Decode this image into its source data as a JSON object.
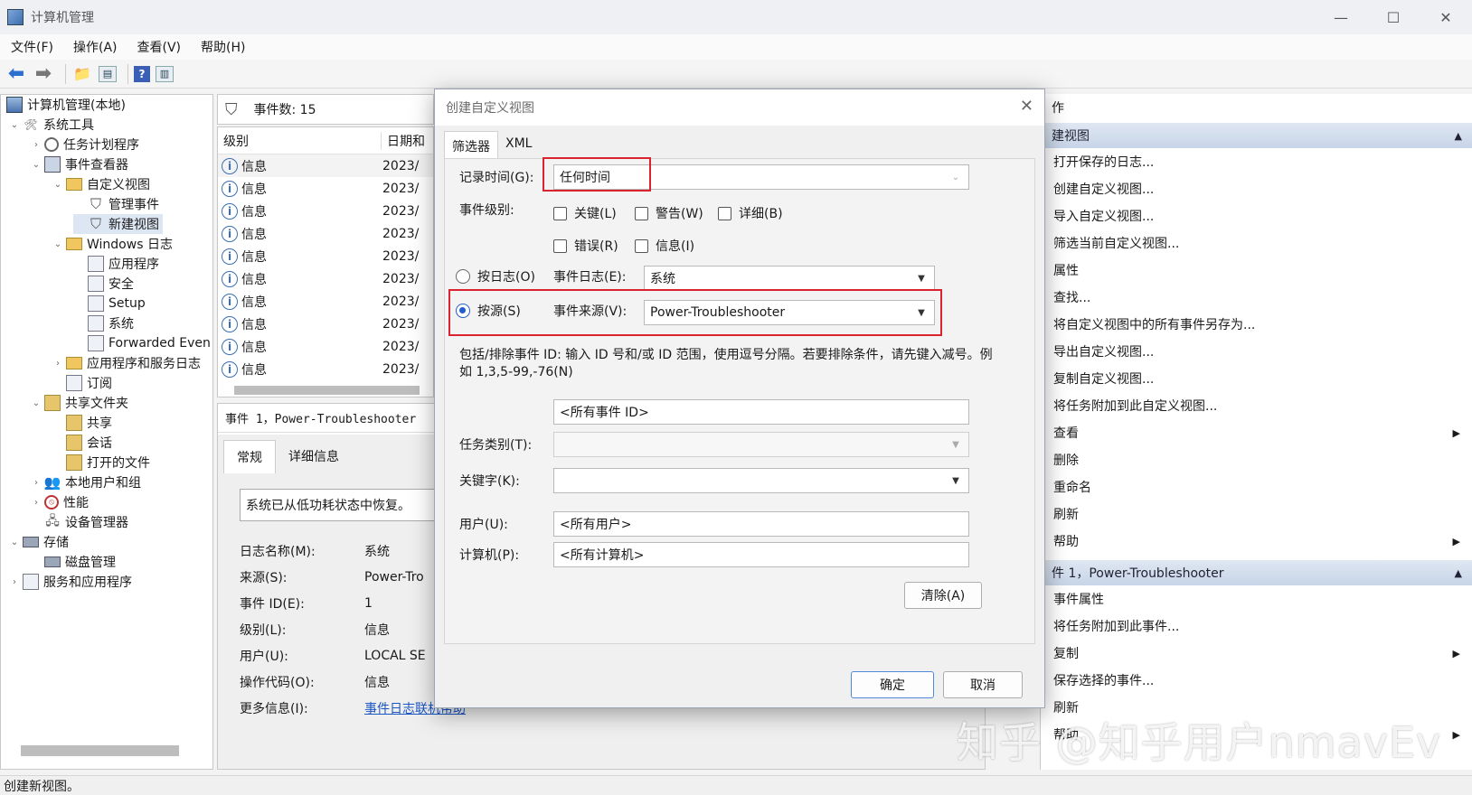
{
  "window": {
    "title": "计算机管理"
  },
  "menu": [
    "文件(F)",
    "操作(A)",
    "查看(V)",
    "帮助(H)"
  ],
  "tree": {
    "items": [
      {
        "label": "计算机管理(本地)"
      },
      {
        "label": "系统工具"
      },
      {
        "label": "任务计划程序"
      },
      {
        "label": "事件查看器"
      },
      {
        "label": "自定义视图"
      },
      {
        "label": "管理事件"
      },
      {
        "label": "新建视图"
      },
      {
        "label": "Windows 日志"
      },
      {
        "label": "应用程序"
      },
      {
        "label": "安全"
      },
      {
        "label": "Setup"
      },
      {
        "label": "系统"
      },
      {
        "label": "Forwarded Even"
      },
      {
        "label": "应用程序和服务日志"
      },
      {
        "label": "订阅"
      },
      {
        "label": "共享文件夹"
      },
      {
        "label": "共享"
      },
      {
        "label": "会话"
      },
      {
        "label": "打开的文件"
      },
      {
        "label": "本地用户和组"
      },
      {
        "label": "性能"
      },
      {
        "label": "设备管理器"
      },
      {
        "label": "存储"
      },
      {
        "label": "磁盘管理"
      },
      {
        "label": "服务和应用程序"
      }
    ]
  },
  "events": {
    "count_label": "事件数: 15",
    "col_level": "级别",
    "col_date": "日期和",
    "rows": [
      {
        "level": "信息",
        "date": "2023/"
      },
      {
        "level": "信息",
        "date": "2023/"
      },
      {
        "level": "信息",
        "date": "2023/"
      },
      {
        "level": "信息",
        "date": "2023/"
      },
      {
        "level": "信息",
        "date": "2023/"
      },
      {
        "level": "信息",
        "date": "2023/"
      },
      {
        "level": "信息",
        "date": "2023/"
      },
      {
        "level": "信息",
        "date": "2023/"
      },
      {
        "level": "信息",
        "date": "2023/"
      },
      {
        "level": "信息",
        "date": "2023/"
      }
    ]
  },
  "detail": {
    "title": "事件 1，Power-Troubleshooter",
    "tabs": [
      "常规",
      "详细信息"
    ],
    "message": "系统已从低功耗状态中恢复。",
    "fields": [
      {
        "label": "日志名称(M):",
        "value": "系统"
      },
      {
        "label": "来源(S):",
        "value": "Power-Tro"
      },
      {
        "label": "事件 ID(E):",
        "value": "1"
      },
      {
        "label": "级别(L):",
        "value": "信息"
      },
      {
        "label": "用户(U):",
        "value": "LOCAL SE"
      },
      {
        "label": "操作代码(O):",
        "value": "信息"
      },
      {
        "label": "更多信息(I):",
        "value": "事件日志联机帮助"
      }
    ]
  },
  "actions": {
    "title": "作",
    "section1": "建视图",
    "items1": [
      "打开保存的日志...",
      "创建自定义视图...",
      "导入自定义视图...",
      "筛选当前自定义视图...",
      "属性",
      "查找...",
      "将自定义视图中的所有事件另存为...",
      "导出自定义视图...",
      "复制自定义视图...",
      "将任务附加到此自定义视图...",
      "查看",
      "删除",
      "重命名",
      "刷新",
      "帮助"
    ],
    "section2": "件 1，Power-Troubleshooter",
    "items2": [
      "事件属性",
      "将任务附加到此事件...",
      "复制",
      "保存选择的事件...",
      "刷新",
      "帮助"
    ]
  },
  "status": "创建新视图。",
  "dialog": {
    "title": "创建自定义视图",
    "tabs": [
      "筛选器",
      "XML"
    ],
    "logged_label": "记录时间(G):",
    "logged_value": "任何时间",
    "level_label": "事件级别:",
    "levels": [
      "关键(L)",
      "警告(W)",
      "详细(B)",
      "错误(R)",
      "信息(I)"
    ],
    "by_log": "按日志(O)",
    "event_log_label": "事件日志(E):",
    "event_log_value": "系统",
    "by_source": "按源(S)",
    "source_label": "事件来源(V):",
    "source_value": "Power-Troubleshooter",
    "note": "包括/排除事件 ID: 输入 ID 号和/或 ID 范围，使用逗号分隔。若要排除条件，请先键入减号。例如 1,3,5-99,-76(N)",
    "event_id_value": "<所有事件 ID>",
    "task_label": "任务类别(T):",
    "keyword_label": "关键字(K):",
    "user_label": "用户(U):",
    "user_value": "<所有用户>",
    "computer_label": "计算机(P):",
    "computer_value": "<所有计算机>",
    "clear_btn": "清除(A)",
    "ok_btn": "确定",
    "cancel_btn": "取消"
  },
  "watermark": "知乎 @知乎用户nmavEv"
}
